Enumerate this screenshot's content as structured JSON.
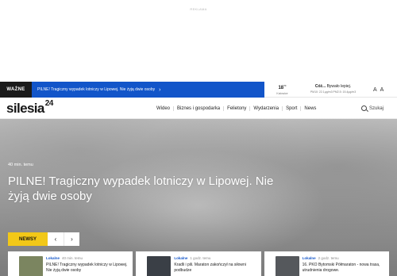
{
  "ad": {
    "label": "REKLAMA"
  },
  "alert": {
    "tag": "WAŻNE",
    "text": "PILNE! Tragiczny wypadek lotniczy w Lipowej. Nie żyją dwie osoby",
    "chevron": "›"
  },
  "weather": {
    "temp": "18",
    "unit": "°C",
    "city": "Katowice"
  },
  "air": {
    "status_prefix": "Cóż...",
    "status_main": " Bywało lepiej.",
    "values": "PM10: 22.1µg/m3 PM2.5: 15.4µg/m3"
  },
  "font_controls": {
    "a1": "A",
    "a2": "A"
  },
  "logo": {
    "name": "silesia",
    "sup": "24"
  },
  "nav": [
    {
      "label": "Wideo"
    },
    {
      "label": "Biznes i gospodarka"
    },
    {
      "label": "Felietony"
    },
    {
      "label": "Wydarzenia"
    },
    {
      "label": "Sport"
    },
    {
      "label": "News"
    }
  ],
  "search": {
    "label": "Szukaj",
    "icon": "search-icon"
  },
  "hero": {
    "time": "40 min. temu",
    "title": "PILNE! Tragiczny wypadek lotniczy w Lipowej. Nie żyją dwie osoby"
  },
  "newsy": {
    "label": "NEWSY",
    "prev": "‹",
    "next": "›"
  },
  "cards": [
    {
      "category": "Lokalne",
      "time": "40 min. temu",
      "title": "PILNE! Tragiczny wypadek lotniczy w Lipowej. Nie żyją dwie osoby",
      "thumb_color": "#7b8560"
    },
    {
      "category": "Lokalne",
      "time": "1 godz. temu",
      "title": "Kradli i pili. Maraton zakończył na siłowni podbudze",
      "thumb_color": "#3a3f46"
    },
    {
      "category": "Lokalne",
      "time": "2 godz. temu",
      "title": "16. PKO Bytomski Półmaraton - nowa trasa, utrudnienia drogowe.",
      "thumb_color": "#55585c"
    }
  ],
  "colors": {
    "accent": "#1255c9",
    "newsy": "#f2c818",
    "dark": "#1b1b1b"
  }
}
